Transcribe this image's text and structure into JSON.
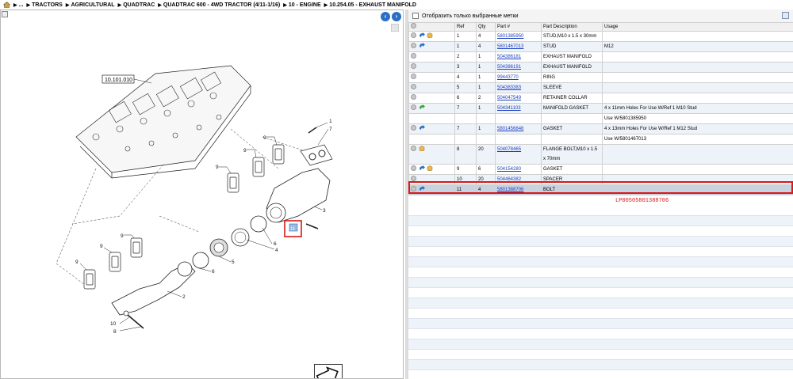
{
  "breadcrumb": {
    "items": [
      "...",
      "TRACTORS",
      "AGRICULTURAL",
      "QUADTRAC",
      "QUADTRAC 600 - 4WD TRACTOR (4/11-1/16)",
      "10 - ENGINE",
      "10.254.05 - EXHAUST MANIFOLD"
    ]
  },
  "diagram": {
    "ref_box": "10.101.010",
    "callouts": [
      "1",
      "7",
      "9",
      "9",
      "9",
      "3",
      "6",
      "4",
      "5",
      "6",
      "9",
      "9",
      "2",
      "10",
      "8",
      "11"
    ]
  },
  "filter": {
    "label": "Отобразить только выбранные метки"
  },
  "table": {
    "headers": [
      "Ref",
      "Qty",
      "Part #",
      "Part Description",
      "Usage"
    ],
    "rows": [
      {
        "ref": "1",
        "qty": "4",
        "part": "5801385950",
        "desc": "STUD,M10 x 1.5 x 30mm",
        "usage": "",
        "icons": [
          "circle",
          "arrow",
          "box"
        ]
      },
      {
        "ref": "1",
        "qty": "4",
        "part": "5801467013",
        "desc": "STUD",
        "usage": "M12",
        "icons": [
          "circle",
          "arrow"
        ]
      },
      {
        "ref": "2",
        "qty": "1",
        "part": "504386181",
        "desc": "EXHAUST MANIFOLD",
        "usage": "",
        "icons": [
          "circle"
        ]
      },
      {
        "ref": "3",
        "qty": "1",
        "part": "504386191",
        "desc": "EXHAUST MANIFOLD",
        "usage": "",
        "icons": [
          "circle"
        ]
      },
      {
        "ref": "4",
        "qty": "1",
        "part": "99443770",
        "desc": "RING",
        "usage": "",
        "icons": [
          "circle"
        ]
      },
      {
        "ref": "5",
        "qty": "1",
        "part": "504383383",
        "desc": "SLEEVE",
        "usage": "",
        "icons": [
          "circle"
        ]
      },
      {
        "ref": "6",
        "qty": "2",
        "part": "504047549",
        "desc": "RETAINER COLLAR",
        "usage": "",
        "icons": [
          "circle"
        ]
      },
      {
        "ref": "7",
        "qty": "1",
        "part": "504341103",
        "desc": "MANIFOLD GASKET",
        "usage": "4 x 11mm Holes For Use W/Ref 1 M10 Stud",
        "icons": [
          "circle",
          "arrow-green"
        ]
      },
      {
        "ref": "",
        "qty": "",
        "part": "",
        "desc": "",
        "usage": "Use W/5801385950",
        "icons": []
      },
      {
        "ref": "7",
        "qty": "1",
        "part": "5801456848",
        "desc": "GASKET",
        "usage": "4 x 13mm Holes For Use W/Ref 1 M12 Stud",
        "icons": [
          "circle",
          "arrow"
        ]
      },
      {
        "ref": "",
        "qty": "",
        "part": "",
        "desc": "",
        "usage": "Use W/5801467013",
        "icons": []
      },
      {
        "ref": "8",
        "qty": "20",
        "part": "504078465",
        "desc": "FLANGE BOLT,M10 x 1.5 x 70mm",
        "usage": "",
        "icons": [
          "circle",
          "box"
        ]
      },
      {
        "ref": "9",
        "qty": "6",
        "part": "504154280",
        "desc": "GASKET",
        "usage": "",
        "icons": [
          "circle",
          "arrow",
          "box"
        ]
      },
      {
        "ref": "10",
        "qty": "20",
        "part": "504464382",
        "desc": "SPACER",
        "usage": "",
        "icons": [
          "circle"
        ]
      },
      {
        "ref": "11",
        "qty": "4",
        "part": "5801388706",
        "desc": "BOLT",
        "usage": "",
        "icons": [
          "circle",
          "arrow"
        ],
        "selected": true
      }
    ]
  },
  "annotation": {
    "text": "LP00505801388706"
  },
  "colors": {
    "accent": "#2a6fc4",
    "link": "#1a3fbf",
    "highlight": "#d81818",
    "selected_row": "#c8d3e2"
  }
}
